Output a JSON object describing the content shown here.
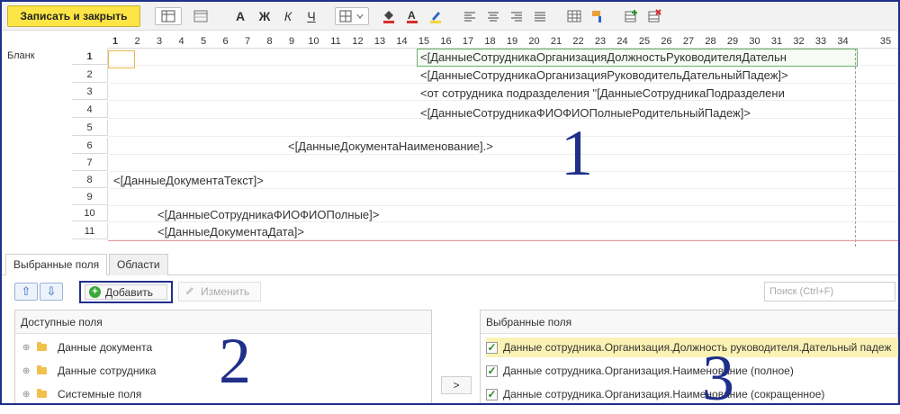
{
  "toolbar": {
    "save_label": "Записать и закрыть",
    "bold": "А",
    "italic_bold": "Ж",
    "italic": "К",
    "underline": "Ч"
  },
  "sheet": {
    "columns": [
      "1",
      "2",
      "3",
      "4",
      "5",
      "6",
      "7",
      "8",
      "9",
      "10",
      "11",
      "12",
      "13",
      "14",
      "15",
      "16",
      "17",
      "18",
      "19",
      "20",
      "21",
      "22",
      "23",
      "24",
      "25",
      "26",
      "27",
      "28",
      "29",
      "30",
      "31",
      "32",
      "33",
      "34",
      "35"
    ],
    "row_area_label": "Бланк",
    "rows": [
      "1",
      "2",
      "3",
      "4",
      "5",
      "6",
      "7",
      "8",
      "9",
      "10",
      "11"
    ],
    "cells": {
      "r1": "<[ДанныеСотрудникаОрганизацияДолжностьРуководителяДательн",
      "r2": "<[ДанныеСотрудникаОрганизацияРуководительДательныйПадеж]>",
      "r3": "<от сотрудника подразделения \"[ДанныеСотрудникаПодразделени",
      "r4": "<[ДанныеСотрудникаФИОФИОПолныеРодительныйПадеж]>",
      "r6": "<[ДанныеДокументаНаименование].>",
      "r8": "<[ДанныеДокументаТекст]>",
      "r10": "<[ДанныеСотрудникаФИОФИОПолные]>",
      "r11": "<[ДанныеДокументаДата]>"
    }
  },
  "annotations": {
    "n1": "1",
    "n2": "2",
    "n3": "3"
  },
  "tabs": {
    "selected_fields": "Выбранные поля",
    "areas": "Области"
  },
  "actions": {
    "add_label": "Добавить",
    "edit_label": "Изменить",
    "search_placeholder": "Поиск (Ctrl+F)",
    "transfer_label": ">"
  },
  "available": {
    "header": "Доступные поля",
    "items": [
      "Данные документа",
      "Данные сотрудника",
      "Системные поля"
    ]
  },
  "selected": {
    "header": "Выбранные поля",
    "items": [
      "Данные сотрудника.Организация.Должность руководителя.Дательный падеж",
      "Данные сотрудника.Организация.Наименование (полное)",
      "Данные сотрудника.Организация.Наименование (сокращенное)"
    ]
  },
  "colors": {
    "accent": "#1f2f8a",
    "save_button": "#fce544",
    "highlight": "#fbf3b5"
  }
}
